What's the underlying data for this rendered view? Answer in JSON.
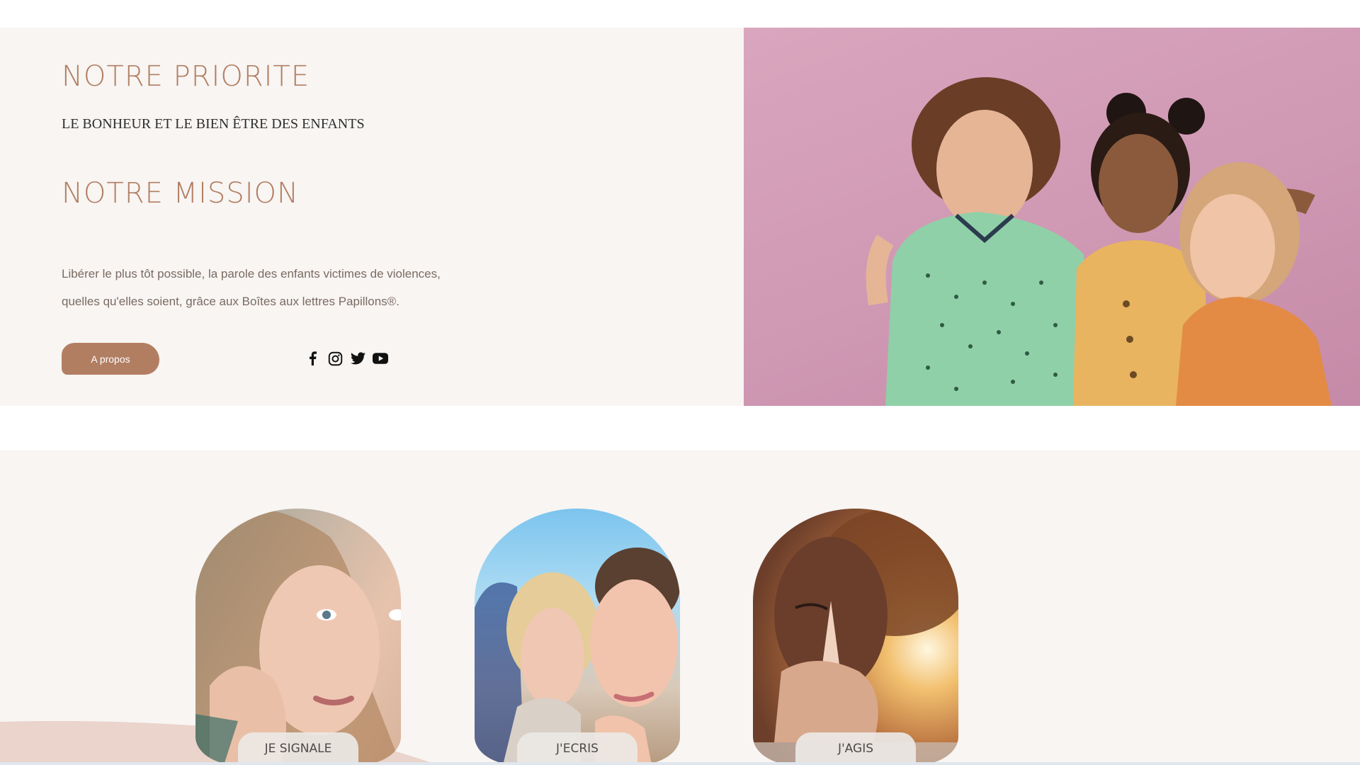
{
  "hero": {
    "priority_title": "NOTRE PRIORITE",
    "priority_subtitle": "LE BONHEUR ET LE BIEN ÊTRE DES ENFANTS",
    "mission_title": "NOTRE MISSION",
    "mission_text": "Libérer le plus tôt possible, la parole des enfants victimes de violences, quelles qu'elles soient, grâce aux Boîtes aux lettres Papillons®.",
    "about_button_label": "A propos",
    "photo_alt": "Trois enfants souriants"
  },
  "socials": [
    {
      "name": "facebook-icon"
    },
    {
      "name": "instagram-icon"
    },
    {
      "name": "twitter-icon"
    },
    {
      "name": "youtube-icon"
    }
  ],
  "cards": [
    {
      "label": "JE SIGNALE"
    },
    {
      "label": "J'ECRIS"
    },
    {
      "label": "J'AGIS"
    }
  ],
  "colors": {
    "accent": "#b27e62",
    "section_bg": "#f8f5f3",
    "hero_photo_bg": "#d3a1b9"
  }
}
